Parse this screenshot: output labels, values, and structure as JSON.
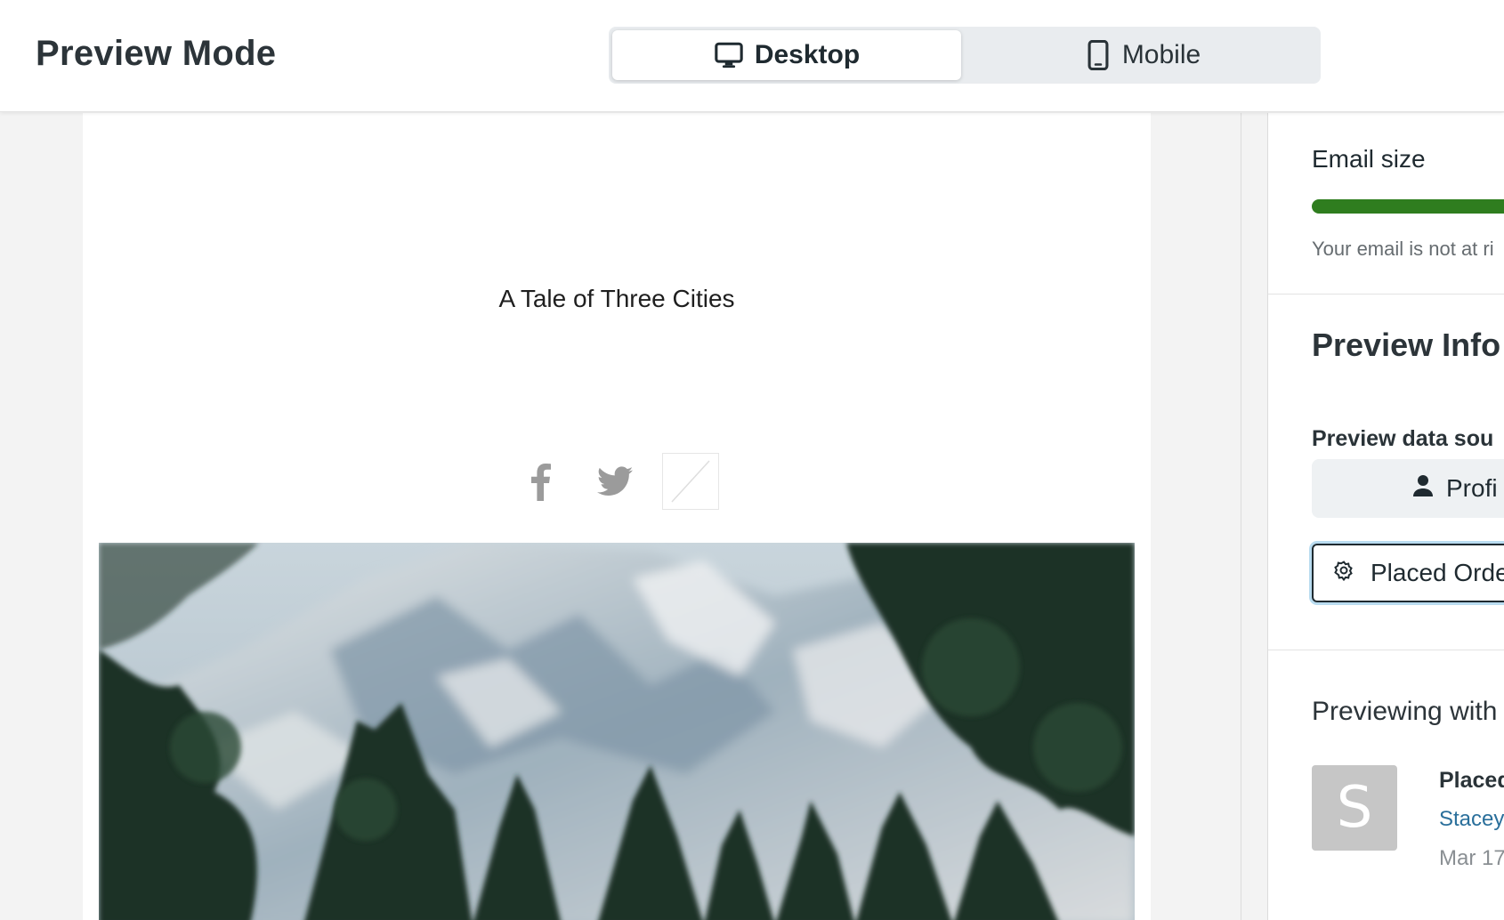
{
  "header": {
    "title": "Preview Mode",
    "toggle": {
      "desktop_label": "Desktop",
      "desktop_icon": "monitor-icon",
      "mobile_label": "Mobile",
      "mobile_icon": "phone-icon",
      "selected": "Desktop"
    }
  },
  "email": {
    "heading": "A Tale of Three Cities",
    "social_icons": [
      "facebook-icon",
      "twitter-icon",
      "broken-image-icon"
    ],
    "hero_image": "mountain-forest-photo"
  },
  "panel": {
    "email_size": {
      "label": "Email size",
      "bar_fill": 1.0,
      "bar_color": "#2f7d1f",
      "note": "Your email is not at ri"
    },
    "preview_info": {
      "title": "Preview Info",
      "source_label": "Preview data sou",
      "profile_button": "Profi",
      "event_select": "Placed Orde"
    },
    "previewing": {
      "title": "Previewing with",
      "avatar_letter": "S",
      "event_name": "Placed",
      "profile_name": "Stacey",
      "date": "Mar 17"
    }
  },
  "colors": {
    "link": "#2a6f9b",
    "focus_ring": "#b9dcf0",
    "avatar_bg": "#c6c6c6"
  }
}
